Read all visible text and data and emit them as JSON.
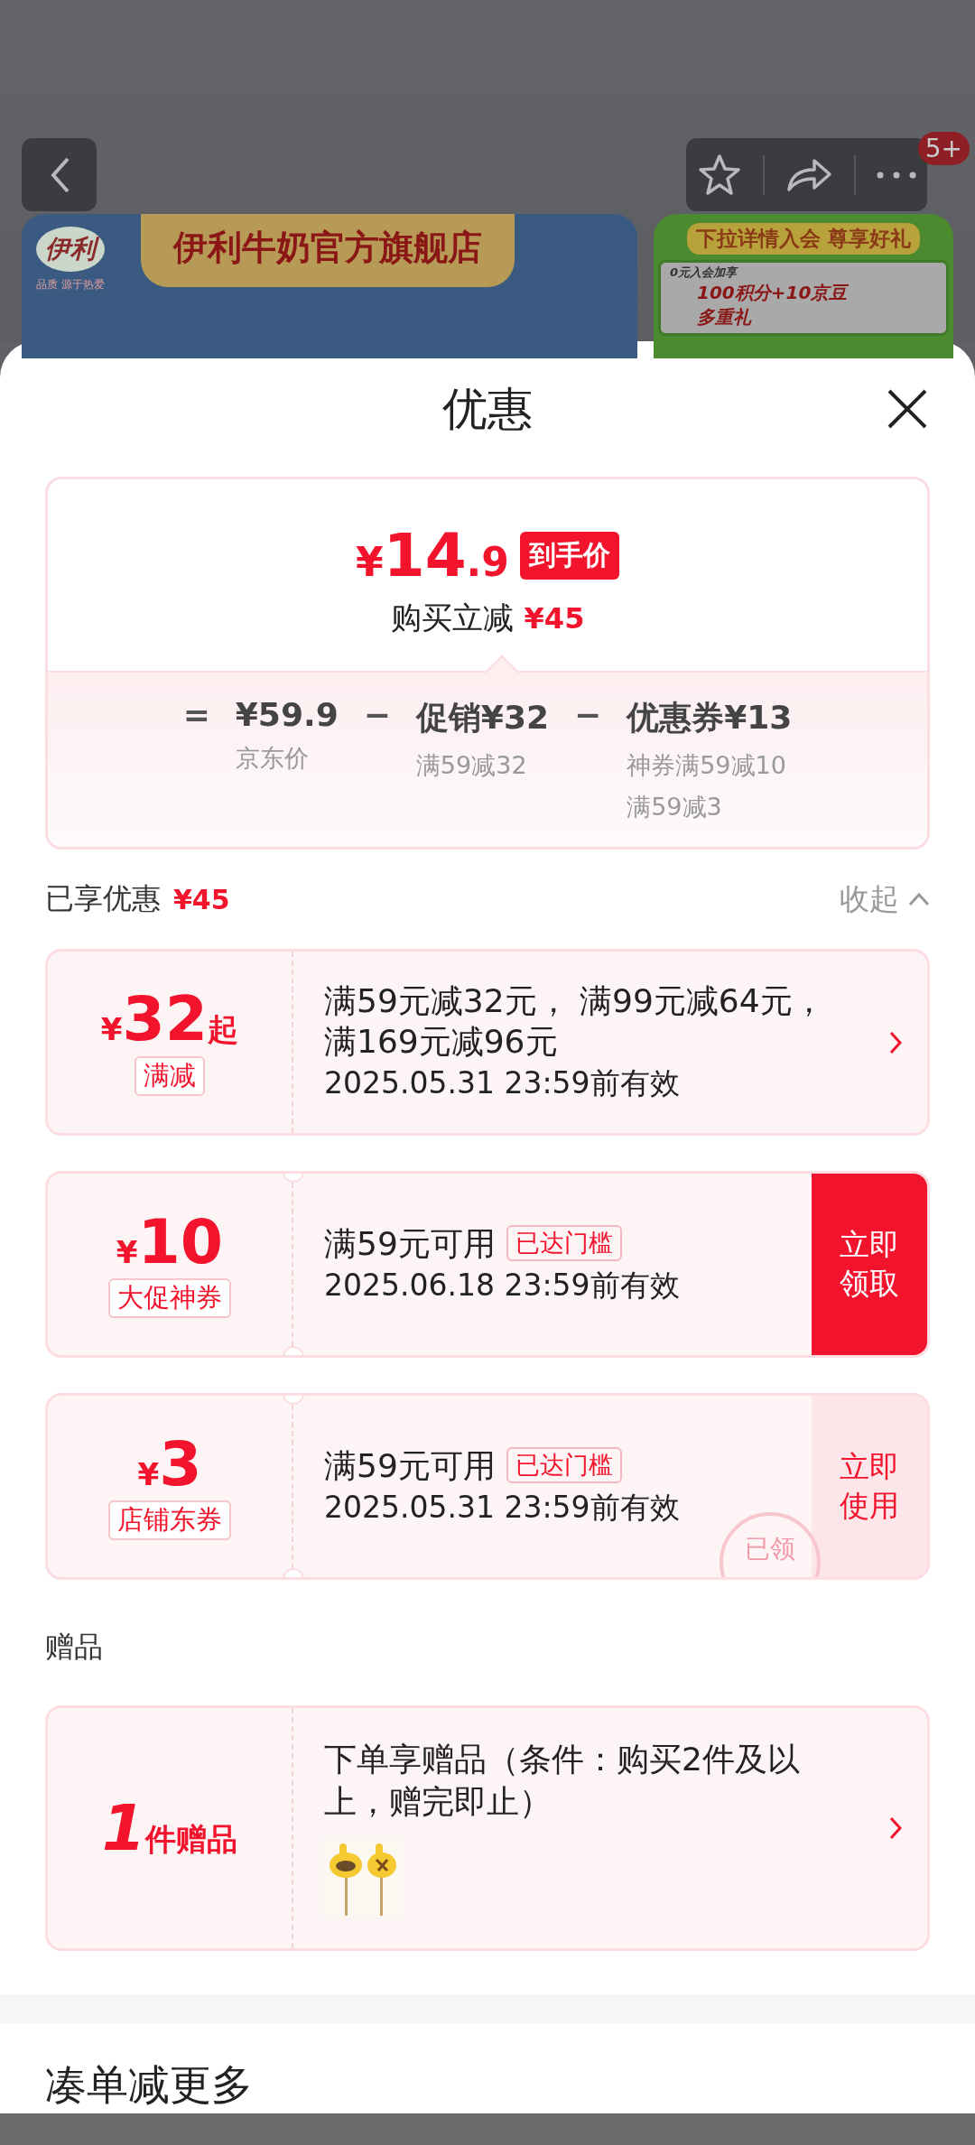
{
  "header": {
    "badge": "5+"
  },
  "store_banner": {
    "logo": "伊利",
    "slogan": "品质 源于热爱",
    "name": "伊利牛奶官方旗舰店"
  },
  "promo_banner": {
    "title": "下拉详情入会 尊享好礼",
    "tag": "0元入会加享",
    "line1": "100积分+10京豆",
    "line2": "多重礼"
  },
  "sheet": {
    "title": "优惠"
  },
  "price": {
    "currency": "¥",
    "integer": "14",
    "decimal": ".9",
    "badge": "到手价",
    "saving_label": "购买立减",
    "saving": "¥45",
    "breakdown": [
      {
        "op": "=",
        "value": "¥59.9",
        "notes": [
          "京东价"
        ]
      },
      {
        "op": "−",
        "label": "促销",
        "value": "¥32",
        "notes": [
          "满59减32"
        ]
      },
      {
        "op": "−",
        "label": "优惠券",
        "value": "¥13",
        "notes": [
          "神券满59减10",
          "满59减3"
        ]
      }
    ]
  },
  "enjoyed": {
    "label": "已享优惠",
    "amount": "¥45",
    "toggle": "收起",
    "expanded": true
  },
  "coupons": [
    {
      "currency": "¥",
      "amount": "32",
      "suffix": "起",
      "tag": "满减",
      "condition": "满59元减32元， 满99元减64元，满169元减96元",
      "validity": "2025.05.31 23:59前有效",
      "action": {
        "kind": "arrow"
      }
    },
    {
      "currency": "¥",
      "amount": "10",
      "tag": "大促神券",
      "condition": "满59元可用",
      "badge": "已达门槛",
      "validity": "2025.06.18 23:59前有效",
      "action": {
        "kind": "button",
        "label": "立即领取",
        "filled": true
      }
    },
    {
      "currency": "¥",
      "amount": "3",
      "tag": "店铺东券",
      "condition": "满59元可用",
      "badge": "已达门槛",
      "validity": "2025.05.31 23:59前有效",
      "stamp": "已领",
      "action": {
        "kind": "button",
        "label": "立即使用",
        "filled": false
      }
    }
  ],
  "gifts": {
    "title": "赠品",
    "count": "1",
    "unit": "件赠品",
    "text": "下单享赠品（条件：购买2件及以上，赠完即止）"
  },
  "more": {
    "title": "凑单减更多"
  }
}
